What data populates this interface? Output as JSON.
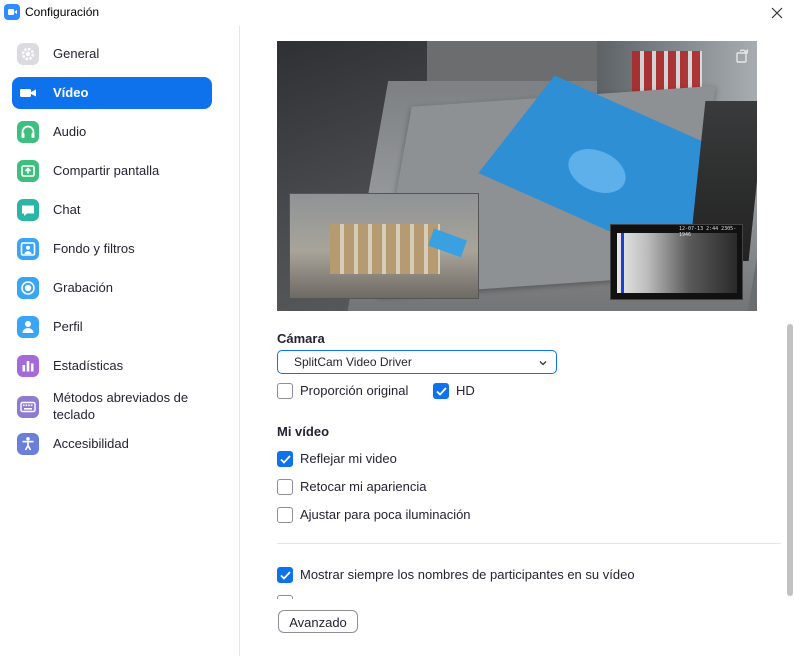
{
  "window": {
    "title": "Configuración"
  },
  "sidebar": {
    "items": [
      {
        "label": "General",
        "icon": "gear-icon",
        "color": "#d9d9de",
        "active": false
      },
      {
        "label": "Vídeo",
        "icon": "video-camera-icon",
        "color": "#0E72ED",
        "active": true
      },
      {
        "label": "Audio",
        "icon": "headphones-icon",
        "color": "#3fbf7f",
        "active": false
      },
      {
        "label": "Compartir pantalla",
        "icon": "share-screen-icon",
        "color": "#3fbf7f",
        "active": false
      },
      {
        "label": "Chat",
        "icon": "chat-bubble-icon",
        "color": "#2bb5a6",
        "active": false
      },
      {
        "label": "Fondo y filtros",
        "icon": "person-portrait-icon",
        "color": "#3aa5f5",
        "active": false
      },
      {
        "label": "Grabación",
        "icon": "record-icon",
        "color": "#3aa5f5",
        "active": false
      },
      {
        "label": "Perfil",
        "icon": "person-icon",
        "color": "#3aa5f5",
        "active": false
      },
      {
        "label": "Estadísticas",
        "icon": "bar-chart-icon",
        "color": "#a56ad9",
        "active": false
      },
      {
        "label": "Métodos abreviados de teclado",
        "icon": "keyboard-icon",
        "color": "#8f7ad1",
        "active": false
      },
      {
        "label": "Accesibilidad",
        "icon": "accessibility-icon",
        "color": "#6a7fd9",
        "active": false
      }
    ]
  },
  "preview": {
    "timestamp": "12-07-13 2:44 2305-1946"
  },
  "camera": {
    "title": "Cámara",
    "selected": "SplitCam Video Driver",
    "original_ratio_label": "Proporción original",
    "original_ratio_checked": false,
    "hd_label": "HD",
    "hd_checked": true
  },
  "my_video": {
    "title": "Mi vídeo",
    "options": [
      {
        "label": "Reflejar mi video",
        "checked": true
      },
      {
        "label": "Retocar mi apariencia",
        "checked": false
      },
      {
        "label": "Ajustar para poca iluminación",
        "checked": false
      }
    ]
  },
  "participants": {
    "show_names_label": "Mostrar siempre los nombres de participantes en su vídeo",
    "show_names_checked": true
  },
  "advanced_button": "Avanzado",
  "colors": {
    "accent": "#0E72ED",
    "text": "#232333",
    "border": "#8e8e9a"
  }
}
